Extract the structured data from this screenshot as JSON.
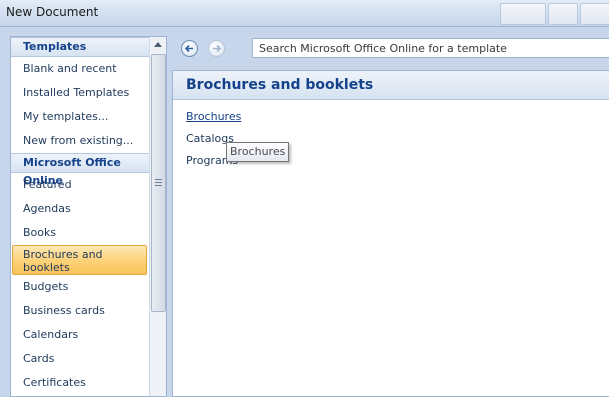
{
  "window": {
    "title": "New Document"
  },
  "sidebar": {
    "sections": [
      {
        "header": "Templates",
        "items": [
          {
            "label": "Blank and recent"
          },
          {
            "label": "Installed Templates"
          },
          {
            "label": "My templates..."
          },
          {
            "label": "New from existing..."
          }
        ]
      },
      {
        "header": "Microsoft Office Online",
        "items": [
          {
            "label": "Featured"
          },
          {
            "label": "Agendas"
          },
          {
            "label": "Books"
          },
          {
            "label": "Brochures and booklets",
            "selected": true
          },
          {
            "label": "Budgets"
          },
          {
            "label": "Business cards"
          },
          {
            "label": "Calendars"
          },
          {
            "label": "Cards"
          },
          {
            "label": "Certificates"
          }
        ]
      }
    ]
  },
  "search": {
    "placeholder": "Search Microsoft Office Online for a template"
  },
  "nav": {
    "back_icon": "back-arrow-icon",
    "forward_icon": "forward-arrow-icon"
  },
  "content": {
    "title": "Brochures and booklets",
    "links": [
      "Brochures",
      "Catalogs",
      "Programs"
    ]
  },
  "tooltip": {
    "text": "Brochures"
  },
  "colors": {
    "selection": "#fdd176",
    "header_text": "#15428b",
    "frame": "#c7d6ea"
  }
}
